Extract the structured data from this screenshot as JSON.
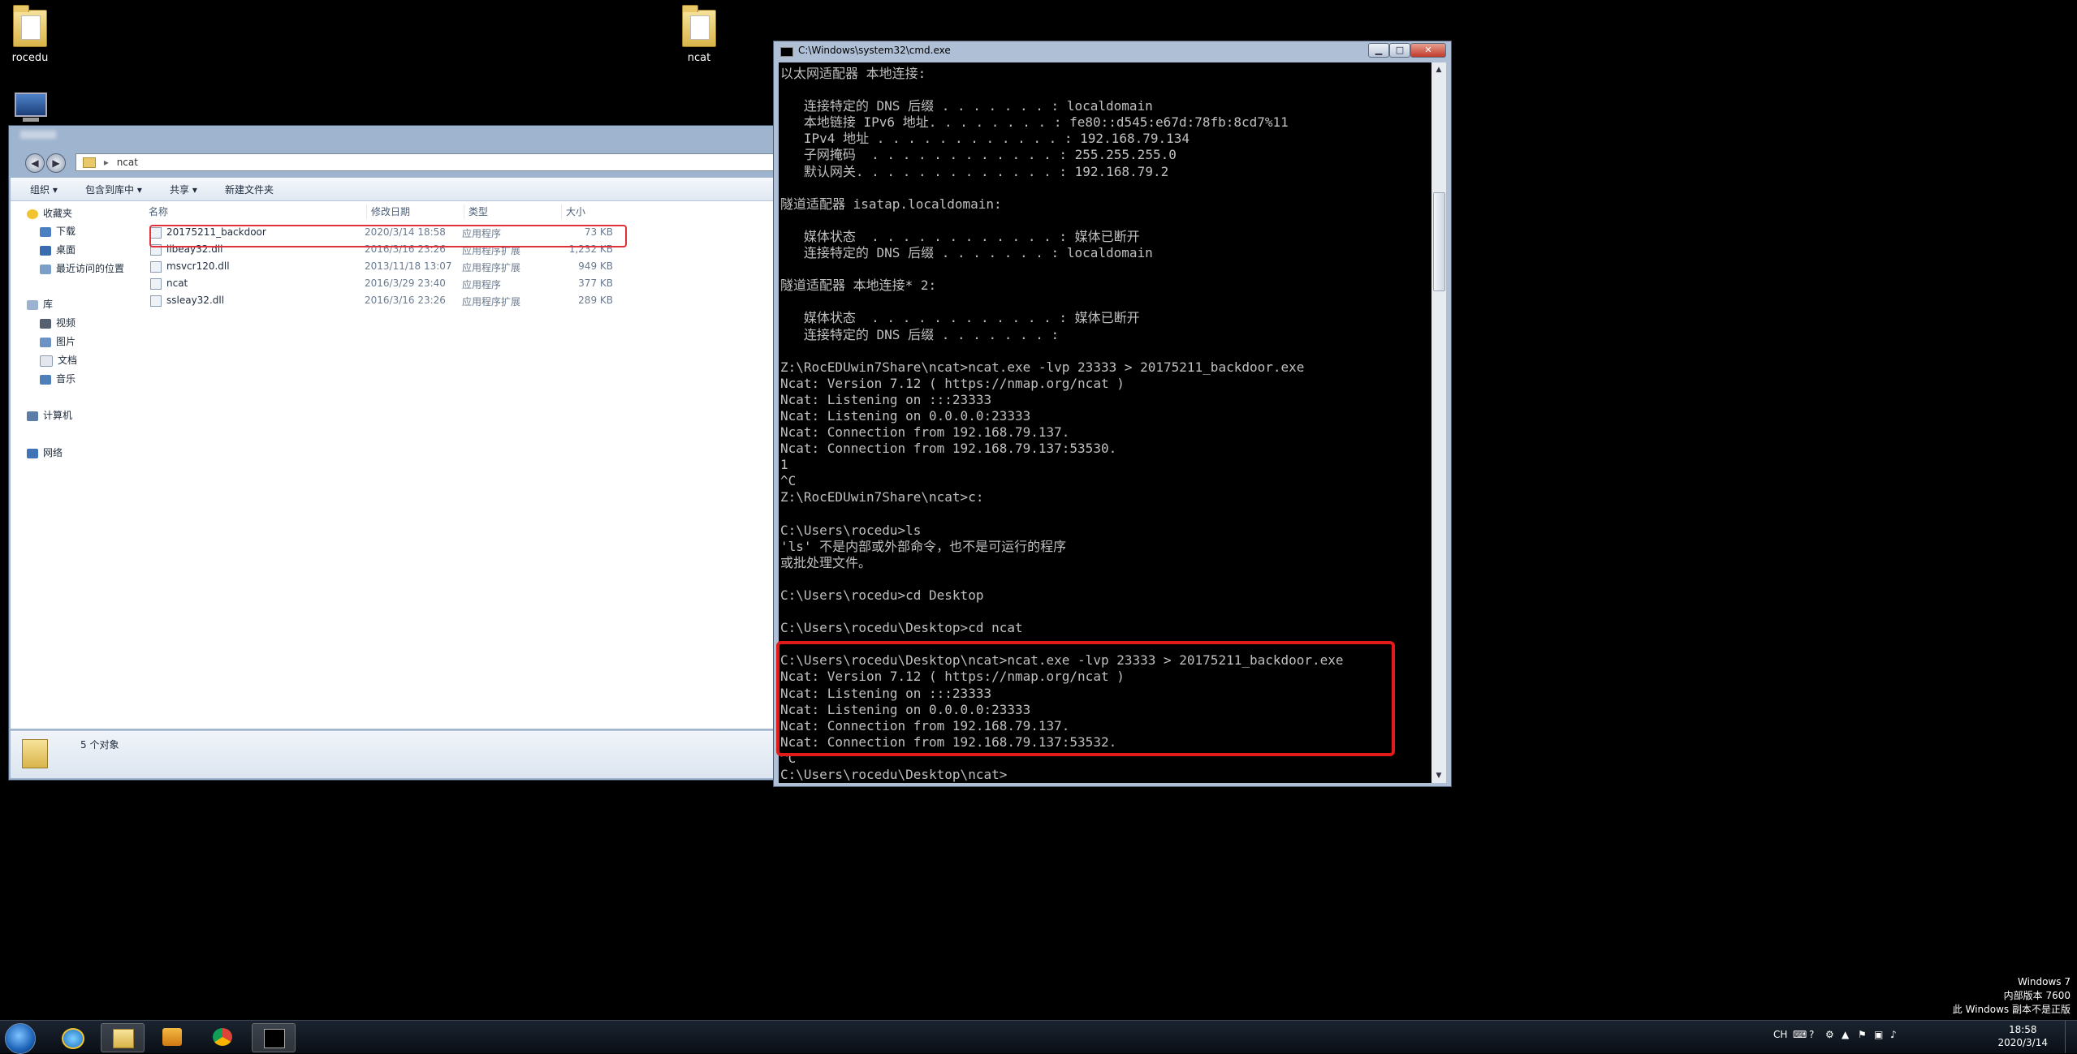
{
  "desktop": {
    "icons": [
      {
        "label": "rocedu"
      },
      {
        "label": "ncat"
      }
    ]
  },
  "explorer": {
    "address": "ncat",
    "toolbar": {
      "organize": "组织 ▾",
      "include_library": "包含到库中 ▾",
      "share": "共享 ▾",
      "new_folder": "新建文件夹"
    },
    "nav": {
      "favorites": "收藏夹",
      "downloads": "下载",
      "desktop": "桌面",
      "recent": "最近访问的位置",
      "libraries": "库",
      "videos": "视频",
      "pictures": "图片",
      "documents": "文档",
      "music": "音乐",
      "computer": "计算机",
      "network": "网络"
    },
    "columns": {
      "name": "名称",
      "date": "修改日期",
      "type": "类型",
      "size": "大小"
    },
    "files": [
      {
        "name": "20175211_backdoor",
        "date": "2020/3/14 18:58",
        "type": "应用程序",
        "size": "73 KB"
      },
      {
        "name": "libeay32.dll",
        "date": "2016/3/16 23:26",
        "type": "应用程序扩展",
        "size": "1,232 KB"
      },
      {
        "name": "msvcr120.dll",
        "date": "2013/11/18 13:07",
        "type": "应用程序扩展",
        "size": "949 KB"
      },
      {
        "name": "ncat",
        "date": "2016/3/29 23:40",
        "type": "应用程序",
        "size": "377 KB"
      },
      {
        "name": "ssleay32.dll",
        "date": "2016/3/16 23:26",
        "type": "应用程序扩展",
        "size": "289 KB"
      }
    ],
    "status": "5 个对象"
  },
  "cmd": {
    "title": "C:\\Windows\\system32\\cmd.exe",
    "output": "以太网适配器 本地连接:\n\n   连接特定的 DNS 后缀 . . . . . . . : localdomain\n   本地链接 IPv6 地址. . . . . . . . : fe80::d545:e67d:78fb:8cd7%11\n   IPv4 地址 . . . . . . . . . . . . : 192.168.79.134\n   子网掩码  . . . . . . . . . . . . : 255.255.255.0\n   默认网关. . . . . . . . . . . . . : 192.168.79.2\n\n隧道适配器 isatap.localdomain:\n\n   媒体状态  . . . . . . . . . . . . : 媒体已断开\n   连接特定的 DNS 后缀 . . . . . . . : localdomain\n\n隧道适配器 本地连接* 2:\n\n   媒体状态  . . . . . . . . . . . . : 媒体已断开\n   连接特定的 DNS 后缀 . . . . . . . :\n\nZ:\\RocEDUwin7Share\\ncat>ncat.exe -lvp 23333 > 20175211_backdoor.exe\nNcat: Version 7.12 ( https://nmap.org/ncat )\nNcat: Listening on :::23333\nNcat: Listening on 0.0.0.0:23333\nNcat: Connection from 192.168.79.137.\nNcat: Connection from 192.168.79.137:53530.\n1\n^C\nZ:\\RocEDUwin7Share\\ncat>c:\n\nC:\\Users\\rocedu>ls\n'ls' 不是内部或外部命令，也不是可运行的程序\n或批处理文件。\n\nC:\\Users\\rocedu>cd Desktop\n\nC:\\Users\\rocedu\\Desktop>cd ncat\n\nC:\\Users\\rocedu\\Desktop\\ncat>ncat.exe -lvp 23333 > 20175211_backdoor.exe\nNcat: Version 7.12 ( https://nmap.org/ncat )\nNcat: Listening on :::23333\nNcat: Listening on 0.0.0.0:23333\nNcat: Connection from 192.168.79.137.\nNcat: Connection from 192.168.79.137:53532.\n^C\nC:\\Users\\rocedu\\Desktop\\ncat>"
  },
  "watermark": {
    "line1": "Windows 7",
    "line2": "内部版本 7600",
    "line3": "此 Windows 副本不是正版"
  },
  "tray": {
    "lang": "CH",
    "time": "18:58",
    "date": "2020/3/14"
  },
  "colors": {
    "highlight_red": "#e21a1a",
    "console_bg": "#000000",
    "console_fg": "#c0c0c0"
  }
}
